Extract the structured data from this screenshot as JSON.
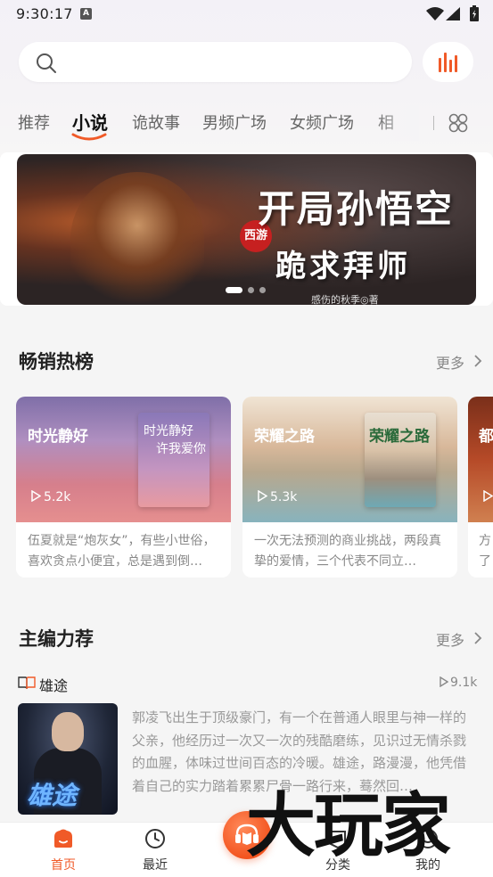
{
  "status_bar": {
    "time": "9:30:17"
  },
  "search": {
    "placeholder": ""
  },
  "tabs": [
    {
      "label": "推荐",
      "active": false
    },
    {
      "label": "小说",
      "active": true
    },
    {
      "label": "诡故事",
      "active": false
    },
    {
      "label": "男频广场",
      "active": false
    },
    {
      "label": "女频广场",
      "active": false
    },
    {
      "label": "相",
      "active": false
    }
  ],
  "banner": {
    "seal": "西游",
    "title_line1": "开局孙悟空",
    "title_line2": "跪求拜师",
    "author": "感伤的秋季◎著",
    "page_count": 3,
    "active_index": 0
  },
  "hot": {
    "title": "畅销热榜",
    "more": "更多",
    "cards": [
      {
        "title": "时光静好",
        "plays": "5.2k",
        "cover_text_1": "时光静好",
        "cover_text_2": "许我爱你",
        "desc": "伍夏就是“炮灰女”，有些小世俗，喜欢贪点小便宜，总是遇到倒…"
      },
      {
        "title": "荣耀之路",
        "plays": "5.3k",
        "cover_text_1": "荣耀之路",
        "desc": "一次无法预测的商业挑战，两段真挚的爱情，三个代表不同立…"
      },
      {
        "title": "都",
        "plays": "",
        "desc": "方了"
      }
    ]
  },
  "editor": {
    "title": "主编力荐",
    "more": "更多",
    "book": {
      "name": "雄途",
      "plays": "9.1k",
      "cover_title": "雄途",
      "desc": "郭凌飞出生于顶级豪门，有一个在普通人眼里与神一样的父亲，他经历过一次又一次的残酷磨练，见识过无情杀戮的血腥，体味过世间百态的冷暖。雄途，路漫漫，他凭借着自己的实力踏着累累尸骨一路行来，蓦然回…"
    }
  },
  "nav": {
    "items": [
      {
        "label": "首页",
        "icon": "home-icon",
        "active": true
      },
      {
        "label": "最近",
        "icon": "clock-icon",
        "active": false
      },
      {
        "label": "",
        "icon": "listen-book-icon",
        "active": false
      },
      {
        "label": "分类",
        "icon": "category-icon",
        "active": false
      },
      {
        "label": "我的",
        "icon": "profile-icon",
        "active": false
      }
    ]
  },
  "watermark": "大玩家",
  "colors": {
    "accent": "#f05a28",
    "text": "#222222",
    "muted": "#888888"
  }
}
